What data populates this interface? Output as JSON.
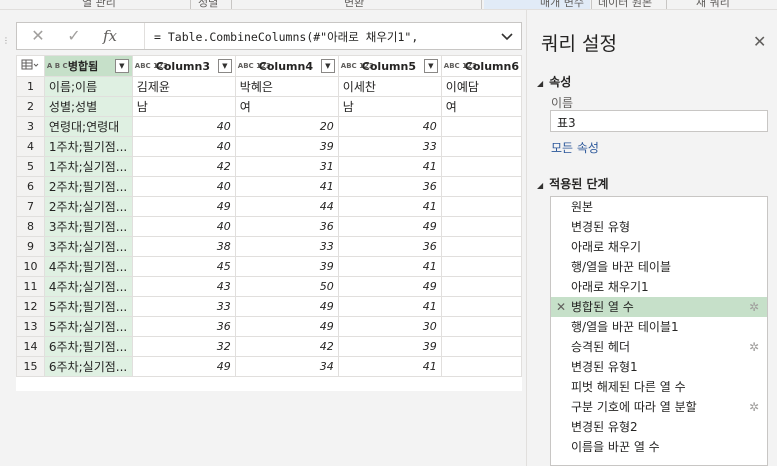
{
  "ribbon": {
    "items": [
      "열 관리",
      "정렬",
      "변환",
      "매개 변수",
      "데이터 원본",
      "새 쿼리"
    ]
  },
  "formula_bar": {
    "cancel_icon": "close-icon",
    "confirm_icon": "check-icon",
    "fx_label": "fx",
    "formula": "= Table.CombineColumns(#\"아래로 채우기1\","
  },
  "grid": {
    "columns": [
      {
        "name": "병합됨",
        "type": "ABC"
      },
      {
        "name": "Column3",
        "type": "ABC123"
      },
      {
        "name": "Column4",
        "type": "ABC123"
      },
      {
        "name": "Column5",
        "type": "ABC123"
      },
      {
        "name": "Column6",
        "type": "ABC123"
      }
    ],
    "type_labels": {
      "abc": "A B C",
      "abc123": "ABC 123"
    },
    "rows": [
      {
        "n": "1",
        "c": [
          "이름;이름",
          "김제윤",
          "박혜은",
          "이세찬",
          "이예담"
        ]
      },
      {
        "n": "2",
        "c": [
          "성별;성별",
          "남",
          "여",
          "남",
          "여"
        ]
      },
      {
        "n": "3",
        "c": [
          "연령대;연령대",
          "40",
          "20",
          "40",
          ""
        ]
      },
      {
        "n": "4",
        "c": [
          "1주차;필기점...",
          "40",
          "39",
          "33",
          ""
        ]
      },
      {
        "n": "5",
        "c": [
          "1주차;실기점...",
          "42",
          "31",
          "41",
          ""
        ]
      },
      {
        "n": "6",
        "c": [
          "2주차;필기점...",
          "40",
          "41",
          "36",
          ""
        ]
      },
      {
        "n": "7",
        "c": [
          "2주차;실기점...",
          "49",
          "44",
          "41",
          ""
        ]
      },
      {
        "n": "8",
        "c": [
          "3주차;필기점...",
          "40",
          "36",
          "49",
          ""
        ]
      },
      {
        "n": "9",
        "c": [
          "3주차;실기점...",
          "38",
          "33",
          "36",
          ""
        ]
      },
      {
        "n": "10",
        "c": [
          "4주차;필기점...",
          "45",
          "39",
          "41",
          ""
        ]
      },
      {
        "n": "11",
        "c": [
          "4주차;실기점...",
          "43",
          "50",
          "49",
          ""
        ]
      },
      {
        "n": "12",
        "c": [
          "5주차;필기점...",
          "33",
          "49",
          "41",
          ""
        ]
      },
      {
        "n": "13",
        "c": [
          "5주차;실기점...",
          "36",
          "49",
          "30",
          ""
        ]
      },
      {
        "n": "14",
        "c": [
          "6주차;필기점...",
          "32",
          "42",
          "39",
          ""
        ]
      },
      {
        "n": "15",
        "c": [
          "6주차;실기점...",
          "49",
          "34",
          "41",
          ""
        ]
      }
    ]
  },
  "panel": {
    "title": "쿼리 설정",
    "close_icon": "close-icon",
    "properties_heading": "속성",
    "name_label": "이름",
    "name_value": "표3",
    "all_properties_link": "모든 속성",
    "applied_steps_heading": "적용된 단계",
    "steps": [
      {
        "label": "원본",
        "gear": false,
        "active": false
      },
      {
        "label": "변경된 유형",
        "gear": false,
        "active": false
      },
      {
        "label": "아래로 채우기",
        "gear": false,
        "active": false
      },
      {
        "label": "행/열을 바꾼 테이블",
        "gear": false,
        "active": false
      },
      {
        "label": "아래로 채우기1",
        "gear": false,
        "active": false
      },
      {
        "label": "병합된 열 수",
        "gear": true,
        "active": true
      },
      {
        "label": "행/열을 바꾼 테이블1",
        "gear": false,
        "active": false
      },
      {
        "label": "승격된 헤더",
        "gear": true,
        "active": false
      },
      {
        "label": "변경된 유형1",
        "gear": false,
        "active": false
      },
      {
        "label": "피벗 해제된 다른 열 수",
        "gear": false,
        "active": false
      },
      {
        "label": "구분 기호에 따라 열 분할",
        "gear": true,
        "active": false
      },
      {
        "label": "변경된 유형2",
        "gear": false,
        "active": false
      },
      {
        "label": "이름을 바꾼 열 수",
        "gear": false,
        "active": false
      }
    ]
  },
  "colors": {
    "selected_column": "#c6e0c9",
    "selected_cell": "#dff0e2",
    "link": "#2b579a"
  }
}
